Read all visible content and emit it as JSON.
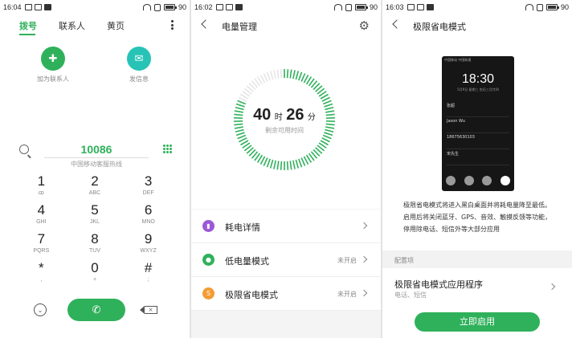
{
  "colors": {
    "accent": "#2fb15b",
    "purple": "#9b59d6",
    "orange": "#f39c34"
  },
  "screen1": {
    "status": {
      "time": "16:04",
      "battery": "90"
    },
    "tabs": [
      "拨号",
      "联系人",
      "黄页"
    ],
    "more_icon": "more-vertical-icon",
    "actions": [
      {
        "label": "加为联系人",
        "icon": "add-contact-icon"
      },
      {
        "label": "发信息",
        "icon": "message-icon"
      }
    ],
    "number": "10086",
    "number_label": "中国移动客服热线",
    "keypad": [
      {
        "digit": "1",
        "letters": "ꝏ"
      },
      {
        "digit": "2",
        "letters": "ABC"
      },
      {
        "digit": "3",
        "letters": "DEF"
      },
      {
        "digit": "4",
        "letters": "GHI"
      },
      {
        "digit": "5",
        "letters": "JKL"
      },
      {
        "digit": "6",
        "letters": "MNO"
      },
      {
        "digit": "7",
        "letters": "PQRS"
      },
      {
        "digit": "8",
        "letters": "TUV"
      },
      {
        "digit": "9",
        "letters": "WXYZ"
      },
      {
        "digit": "*",
        "letters": ","
      },
      {
        "digit": "0",
        "letters": "+"
      },
      {
        "digit": "#",
        "letters": ";"
      }
    ]
  },
  "screen2": {
    "status": {
      "time": "16:02",
      "battery": "90"
    },
    "title": "电量管理",
    "remaining": {
      "hours": "40",
      "hours_unit": "时",
      "minutes": "26",
      "minutes_unit": "分",
      "label": "剩余可用时间"
    },
    "battery_level_fraction": 0.9,
    "rows": [
      {
        "label": "耗电详情",
        "status": "",
        "icon": "chart-icon",
        "color": "#9b59d6"
      },
      {
        "label": "低电量模式",
        "status": "未开启",
        "icon": "leaf-icon",
        "color": "#2fb15b"
      },
      {
        "label": "极限省电模式",
        "status": "未开启",
        "icon": "s-icon",
        "color": "#f39c34"
      }
    ]
  },
  "screen3": {
    "status": {
      "time": "16:03",
      "battery": "90"
    },
    "title": "极限省电模式",
    "preview": {
      "status": "中国移动 中国联通",
      "time": "18:30",
      "date": "5月9日 星期三 农历三月廿四",
      "contacts": [
        {
          "name": "张超",
          "sub": ""
        },
        {
          "name": "Jason Wu",
          "sub": ""
        },
        {
          "name": "18675630103",
          "sub": ""
        },
        {
          "name": "宋先生",
          "sub": ""
        }
      ]
    },
    "description": "极限省电模式将进入黑白桌面并将耗电量降至最低。启用后将关闭蓝牙、GPS、音效、触摸反馈等功能，停用除电话、短信外等大部分应用",
    "section_header": "配置项",
    "option": {
      "title": "极限省电模式应用程序",
      "subtitle": "电话、短信"
    },
    "cta": "立即启用"
  }
}
